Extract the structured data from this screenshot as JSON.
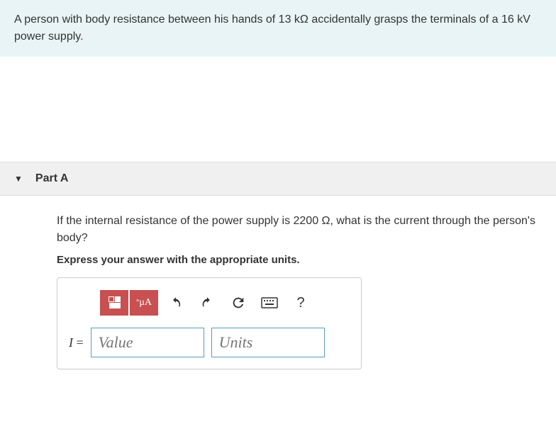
{
  "problem": {
    "text_before_r": "A person with body resistance between his hands of 13 ",
    "unit_r": "kΩ",
    "text_middle": " accidentally grasps the terminals of a 16 ",
    "unit_v": "kV",
    "text_after": " power supply."
  },
  "part": {
    "label": "Part A",
    "question_before": "If the internal resistance of the power supply is 2200 ",
    "unit_ohm": "Ω",
    "question_after": ", what is the current through the person's body?",
    "instruction": "Express your answer with the appropriate units."
  },
  "toolbar": {
    "units_label": "μA",
    "help_label": "?"
  },
  "answer": {
    "variable": "I",
    "equals": " = ",
    "value_placeholder": "Value",
    "units_placeholder": "Units"
  }
}
